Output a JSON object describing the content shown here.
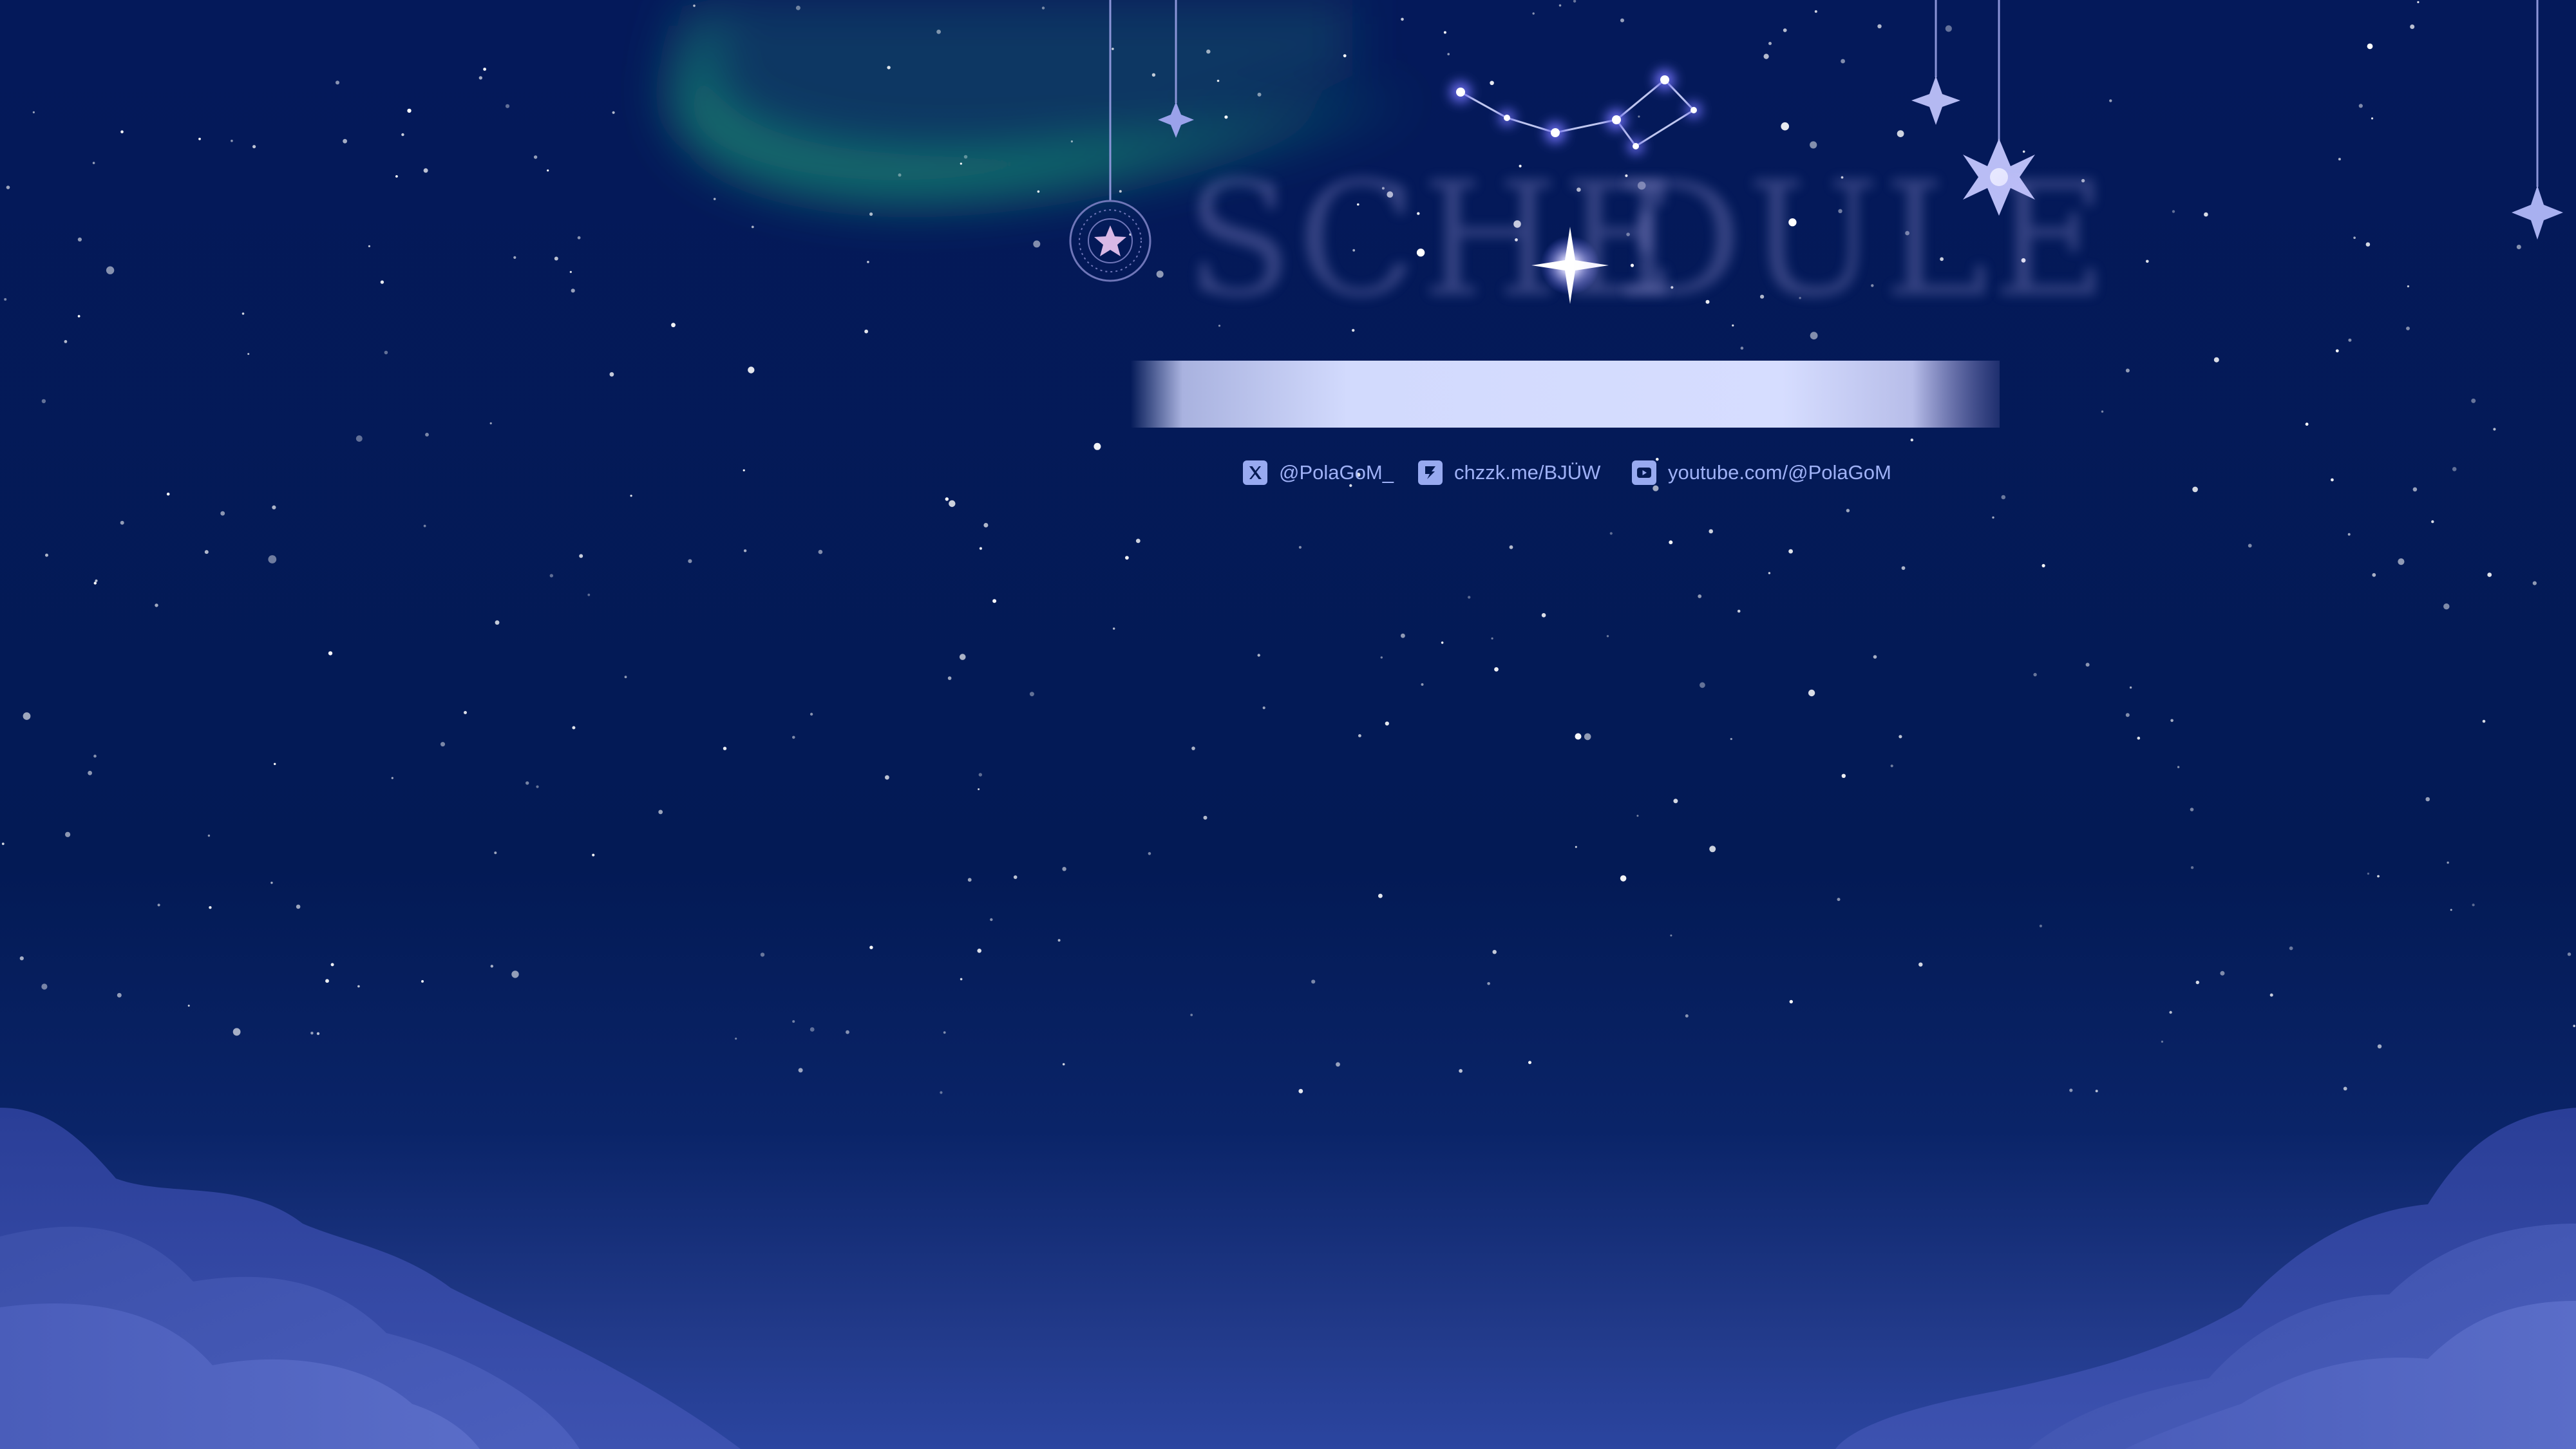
{
  "title": {
    "left": "SCHE",
    "right": "DULE"
  },
  "links": [
    {
      "icon": "x-logo-icon",
      "text": "@PolaGoM_"
    },
    {
      "icon": "chzzk-logo-icon",
      "text": "chzzk.me/BJÜW"
    },
    {
      "icon": "youtube-logo-icon",
      "text": "youtube.com/@PolaGoM"
    }
  ],
  "colors": {
    "sky": "#031a55",
    "aurora": "#1f9a7a",
    "banner": "#d4dcff",
    "link_text": "#9fb1f6",
    "clouds": "#5568c4"
  }
}
